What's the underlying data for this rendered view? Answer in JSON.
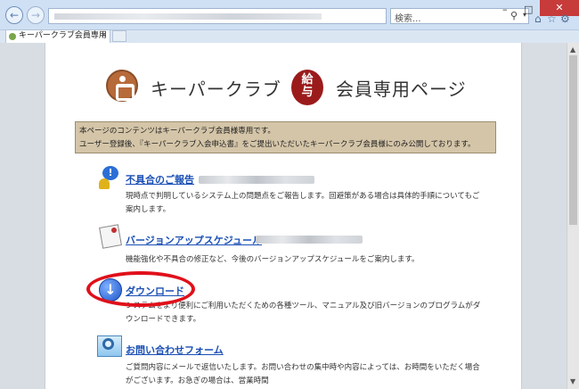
{
  "browser": {
    "search_placeholder": "検索...",
    "tab_title": "キーパークラブ会員専用ページ",
    "tab_close": "×",
    "back_glyph": "←",
    "forward_glyph": "→",
    "min_glyph": "–",
    "max_glyph": "□",
    "close_glyph": "✕",
    "search_glyph": "⚲",
    "dropdown_glyph": "▾",
    "home_icon_glyph": "⌂",
    "favorites_icon_glyph": "☆",
    "tools_icon_glyph": "⚙",
    "scroll_up_glyph": "▲",
    "scroll_down_glyph": "▼"
  },
  "header": {
    "site_title": "キーパークラブ",
    "badge_text": "給\n与",
    "site_subtitle": "会員専用ページ"
  },
  "notice": {
    "line1": "本ページのコンテンツはキーパークラブ会員様専用です。",
    "line2": "ユーザー登録後、『キーパークラブ入会申込書』をご提出いただいたキーパークラブ会員様にのみ公開しております。"
  },
  "sections": [
    {
      "title": "不具合のご報告",
      "desc": "現時点で判明しているシステム上の問題点をご報告します。回避策がある場合は具体的手順についてもご案内します。",
      "icon_glyph": "!"
    },
    {
      "title": "バージョンアップスケジュール",
      "desc": "機能強化や不具合の修正など、今後のバージョンアップスケジュールをご案内します。"
    },
    {
      "title": "ダウンロード",
      "desc": "システムをより便利にご利用いただくための各種ツール、マニュアル及び旧バージョンのプログラムがダウンロードできます。",
      "icon_glyph": "↓"
    },
    {
      "title": "お問い合わせフォーム",
      "desc": "ご質問内容にメールで返信いたします。お問い合わせの集中時や内容によっては、お時間をいただく場合がございます。お急ぎの場合は、営業時間"
    }
  ],
  "colors": {
    "link": "#1a4fb5",
    "notice_bg": "#d4c5a8",
    "badge": "#9b1b1b",
    "highlight": "#e0101a"
  }
}
